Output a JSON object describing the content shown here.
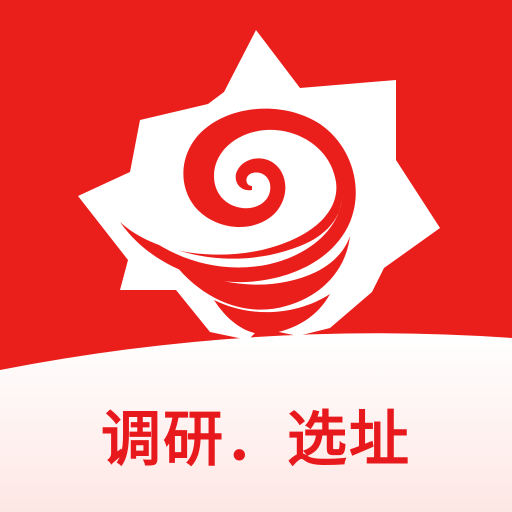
{
  "app_icon": {
    "colors": {
      "brand_red": "#ea1f1c",
      "emblem_white": "#ffffff",
      "tagline_red": "#e8191c",
      "band_top": "#ffffff",
      "band_bottom": "#fde7e4"
    },
    "emblem_icon": "spiral-sun-logo-icon",
    "tagline": "调研．选址"
  }
}
